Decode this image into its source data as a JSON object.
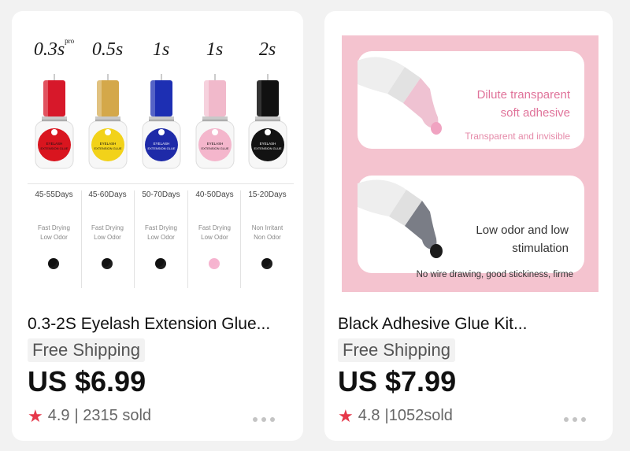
{
  "products": [
    {
      "image": {
        "columns": [
          {
            "speed": "0.3s",
            "speed_sup": "pro",
            "cap": "#d7182a",
            "label": "#d9151f",
            "days": "45-55Days",
            "f1": "Fast Drying",
            "f2": "Low Odor",
            "drop": "black"
          },
          {
            "speed": "0.5s",
            "speed_sup": "",
            "cap": "#d4a84a",
            "label": "#f2d21a",
            "days": "45-60Days",
            "f1": "Fast Drying",
            "f2": "Low Odor",
            "drop": "black"
          },
          {
            "speed": "1s",
            "speed_sup": "",
            "cap": "#1d2fb3",
            "label": "#1e2aa8",
            "days": "50-70Days",
            "f1": "Fast Drying",
            "f2": "Low Odor",
            "drop": "black"
          },
          {
            "speed": "1s",
            "speed_sup": "",
            "cap": "#f1b9cb",
            "label": "#f4b6cc",
            "days": "40-50Days",
            "f1": "Fast Drying",
            "f2": "Low Odor",
            "drop": "pink"
          },
          {
            "speed": "2s",
            "speed_sup": "",
            "cap": "#111111",
            "label": "#121212",
            "days": "15-20Days",
            "f1": "Non Irritant",
            "f2": "Non Odor",
            "drop": "black"
          }
        ],
        "bottle_text_1": "EYELASH",
        "bottle_text_2": "EXTENSION GLUE"
      },
      "title": "0.3-2S Eyelash Extension Glue...",
      "shipping": "Free Shipping",
      "price": "US $6.99",
      "rating": "4.9",
      "sold": "| 2315 sold"
    },
    {
      "image": {
        "panel1_line1": "Dilute transparent",
        "panel1_line2": "soft adhesive",
        "panel1_sub": "Transparent and invisible",
        "panel2_line1": "Low odor and low",
        "panel2_line2": "stimulation",
        "panel2_sub": "No wire drawing, good stickiness, firme"
      },
      "title": "Black Adhesive Glue Kit...",
      "shipping": "Free Shipping",
      "price": "US $7.99",
      "rating": "4.8",
      "sold": "|1052sold"
    }
  ],
  "colors": {
    "star": "#e6384a",
    "background": "#f2f2f2",
    "card": "#ffffff",
    "pink_bg": "#f4c3cf"
  },
  "icons": {
    "rating": "star-icon",
    "menu": "more-dots-icon"
  }
}
